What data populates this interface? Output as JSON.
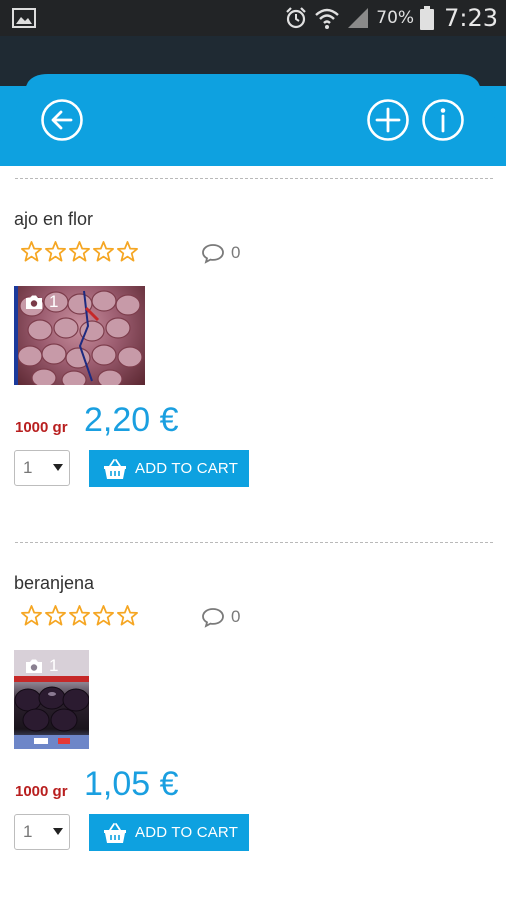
{
  "status_bar": {
    "battery": "70%",
    "time": "7:23"
  },
  "colors": {
    "accent": "#0ea1e0",
    "header_dark": "#1f2a33",
    "price": "#1a9fe0",
    "weight": "#b81f1f",
    "stars": "#f5a623"
  },
  "header": {
    "icons": [
      "back-arrow-icon",
      "add-icon",
      "info-icon"
    ]
  },
  "products": [
    {
      "name": "ajo en flor",
      "rating": 0,
      "comments": "0",
      "photos": "1",
      "weight": "1000 gr",
      "price": "2,20 €",
      "quantity": "1",
      "cart_label": "ADD TO CART"
    },
    {
      "name": "beranjena",
      "rating": 0,
      "comments": "0",
      "photos": "1",
      "weight": "1000 gr",
      "price": "1,05 €",
      "quantity": "1",
      "cart_label": "ADD TO CART"
    }
  ]
}
